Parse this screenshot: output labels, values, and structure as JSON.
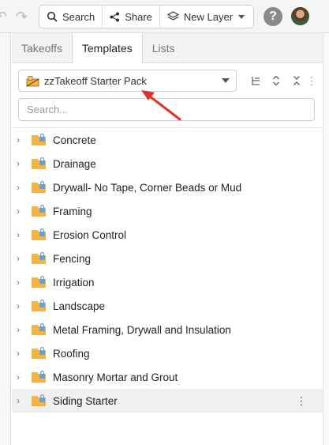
{
  "toolbar": {
    "undo_icon": "undo-icon",
    "redo_icon": "redo-icon",
    "search_label": "Search",
    "share_label": "Share",
    "new_layer_label": "New Layer",
    "help_label": "?"
  },
  "tabs": [
    {
      "label": "Takeoffs",
      "active": false
    },
    {
      "label": "Templates",
      "active": true
    },
    {
      "label": "Lists",
      "active": false
    }
  ],
  "template_selector": {
    "value": "zzTakeoff Starter Pack"
  },
  "search": {
    "placeholder": "Search..."
  },
  "templates": [
    {
      "label": "Concrete"
    },
    {
      "label": "Drainage"
    },
    {
      "label": "Drywall- No Tape, Corner Beads or Mud"
    },
    {
      "label": "Framing"
    },
    {
      "label": "Erosion Control"
    },
    {
      "label": "Fencing"
    },
    {
      "label": "Irrigation"
    },
    {
      "label": "Landscape"
    },
    {
      "label": "Metal Framing, Drywall and Insulation"
    },
    {
      "label": "Roofing"
    },
    {
      "label": "Masonry Mortar and Grout"
    },
    {
      "label": "Siding Starter",
      "highlighted": true
    }
  ],
  "colors": {
    "folder": "#f5b342",
    "lock": "#6aa0d8",
    "arrow": "#e0302a"
  }
}
